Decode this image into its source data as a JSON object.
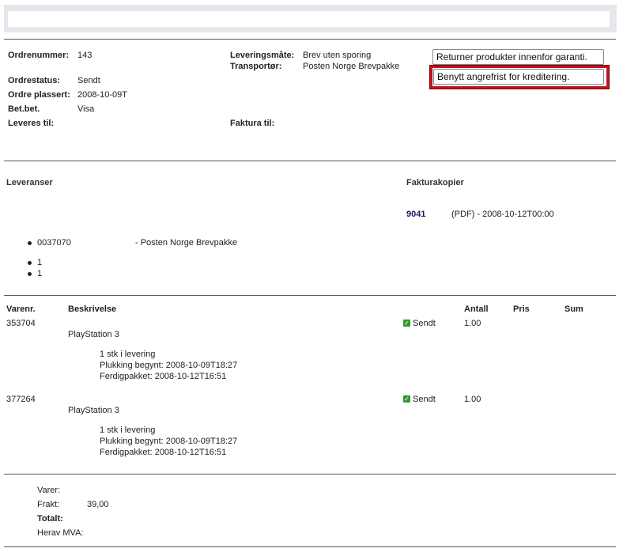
{
  "order": {
    "number_label": "Ordrenummer:",
    "number_value": "143",
    "status_label": "Ordrestatus:",
    "status_value": "Sendt",
    "placed_label": "Ordre plassert:",
    "placed_value": "2008-10-09T",
    "payment_label": "Bet.bet.",
    "payment_value": "Visa",
    "deliver_to_label": "Leveres til:",
    "delivery_method_label": "Leveringsmåte:",
    "delivery_method_value": "Brev uten sporing",
    "carrier_label": "Transportør:",
    "carrier_value": "Posten Norge Brevpakke",
    "invoice_to_label": "Faktura til:"
  },
  "actions": {
    "return_label": "Returner produkter innenfor garanti.",
    "withdraw_label": "Benytt angrefrist for kreditering."
  },
  "deliveries": {
    "title": "Leveranser",
    "shipment_id": "0037070",
    "shipment_carrier": "- Posten Norge Brevpakke",
    "sub_items": [
      "1",
      "1"
    ]
  },
  "invoices": {
    "title": "Fakturakopier",
    "number": "9041",
    "desc": "(PDF) - 2008-10-12T00:00"
  },
  "items": {
    "headers": {
      "item_no": "Varenr.",
      "desc": "Beskrivelse",
      "qty": "Antall",
      "price": "Pris",
      "sum": "Sum"
    },
    "rows": [
      {
        "item_no": "353704",
        "name": "PlayStation 3",
        "status": "Sendt",
        "qty": "1.00",
        "line1": "1 stk i levering",
        "line2": "Plukking begynt: 2008-10-09T18:27",
        "line3": "Ferdigpakket: 2008-10-12T16:51"
      },
      {
        "item_no": "377264",
        "name": "PlayStation 3",
        "status": "Sendt",
        "qty": "1.00",
        "line1": "1 stk i levering",
        "line2": "Plukking begynt: 2008-10-09T18:27",
        "line3": "Ferdigpakket: 2008-10-12T16:51"
      }
    ]
  },
  "totals": {
    "goods_label": "Varer:",
    "freight_label": "Frakt:",
    "freight_value": "39,00",
    "total_label": "Totalt:",
    "vat_label": "Herav MVA:"
  },
  "colors": {
    "accent_red": "#c1121c",
    "status_green": "#2e9a2e",
    "invoice_link": "#1a1a5e"
  }
}
